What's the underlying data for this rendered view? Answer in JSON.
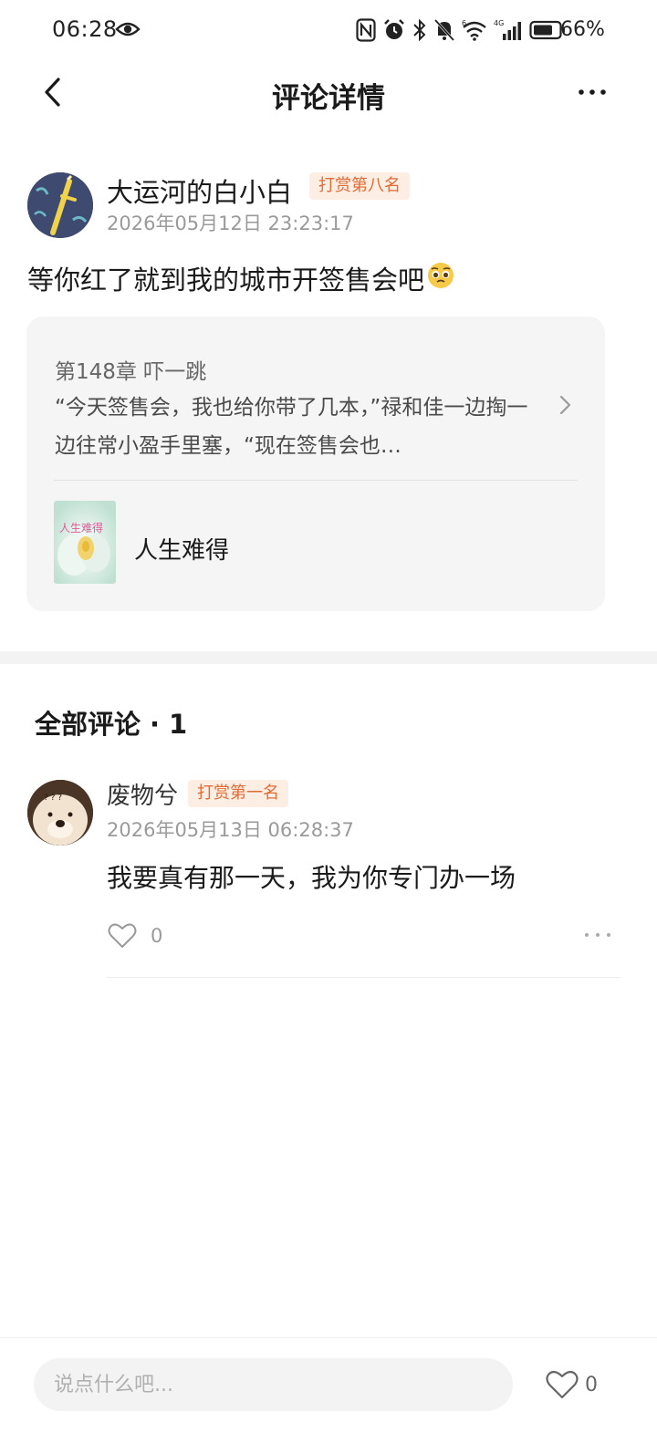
{
  "status_bar": {
    "time": "06:28",
    "battery_percent": "66%",
    "network_label": "4G",
    "wifi_label": "6"
  },
  "header": {
    "title": "评论详情"
  },
  "post": {
    "author_name": "大运河的白小白",
    "tip_badge": "打赏第八名",
    "timestamp": "2026年05月12日 23:23:17",
    "text": "等你红了就到我的城市开签售会吧",
    "emoji": "🥺",
    "quote_card": {
      "chapter_title": "第148章 吓一跳",
      "excerpt": "“今天签售会，我也给你带了几本，”禄和佳一边掏一边往常小盈手里塞，“现在签售会也…",
      "book_title": "人生难得",
      "cover_text": "人生难得"
    }
  },
  "comments_section": {
    "heading": "全部评论",
    "separator": "·",
    "count": "1",
    "comments": [
      {
        "author_name": "废物兮",
        "tip_badge": "打赏第一名",
        "timestamp": "2026年05月13日 06:28:37",
        "text": "我要真有那一天，我为你专门办一场",
        "like_count": "0"
      }
    ]
  },
  "bottom_bar": {
    "input_placeholder": "说点什么吧...",
    "like_count": "0"
  },
  "icons": {
    "back": "chevron-left-icon",
    "more": "more-dots-icon",
    "like": "heart-outline-icon",
    "card_arrow": "chevron-right-icon"
  },
  "colors": {
    "badge_text": "#e06b35",
    "badge_bg": "#fdeee4",
    "card_bg": "#f5f5f5",
    "muted_text": "#9a9a9a"
  }
}
